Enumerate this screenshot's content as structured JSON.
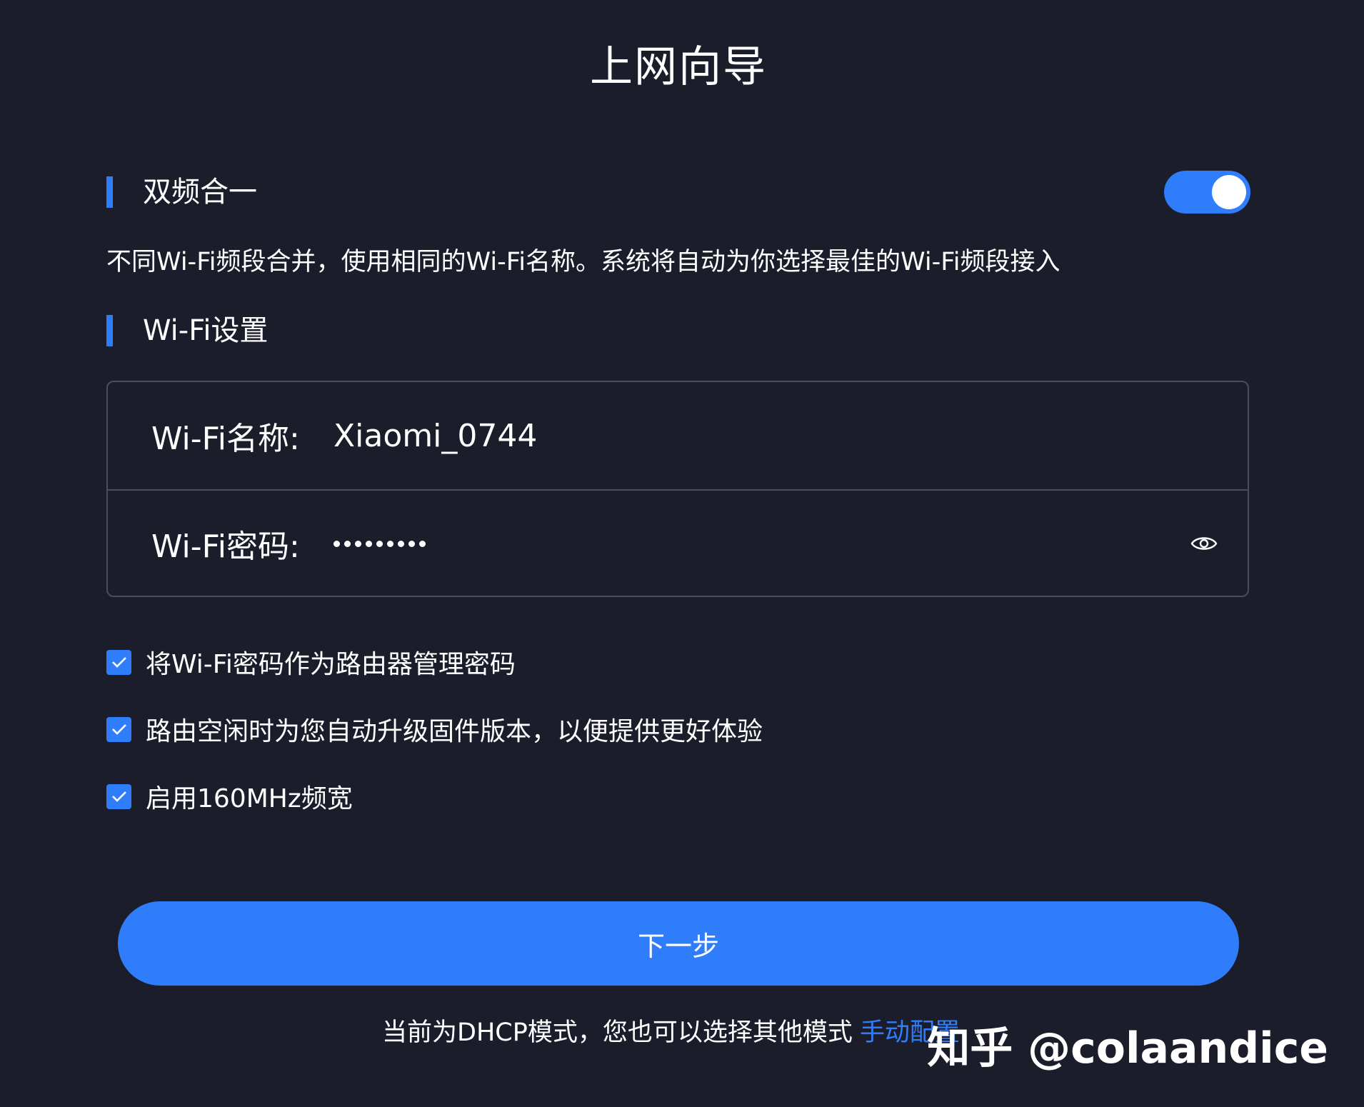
{
  "page": {
    "title": "上网向导"
  },
  "dual_band": {
    "title": "双频合一",
    "enabled": true,
    "description": "不同Wi-Fi频段合并，使用相同的Wi-Fi名称。系统将自动为你选择最佳的Wi-Fi频段接入"
  },
  "wifi_settings": {
    "title": "Wi-Fi设置",
    "name_label": "Wi-Fi名称:",
    "name_value": "Xiaomi_0744",
    "password_label": "Wi-Fi密码:",
    "password_masked": "•••••••••",
    "password_length": 9
  },
  "options": [
    {
      "label": "将Wi-Fi密码作为路由器管理密码",
      "checked": true
    },
    {
      "label": "路由空闲时为您自动升级固件版本，以便提供更好体验",
      "checked": true
    },
    {
      "label": "启用160MHz频宽",
      "checked": true
    }
  ],
  "actions": {
    "next_label": "下一步"
  },
  "footer": {
    "note": "当前为DHCP模式，您也可以选择其他模式",
    "manual_link": "手动配置"
  },
  "watermark": {
    "text": "知乎 @colaandice"
  },
  "colors": {
    "background": "#1b1d2b",
    "accent": "#2f7dfb",
    "border": "#4a4d5c",
    "text": "#ffffff"
  },
  "icons": {
    "password_toggle": "eye-icon",
    "checkbox": "check-icon"
  }
}
